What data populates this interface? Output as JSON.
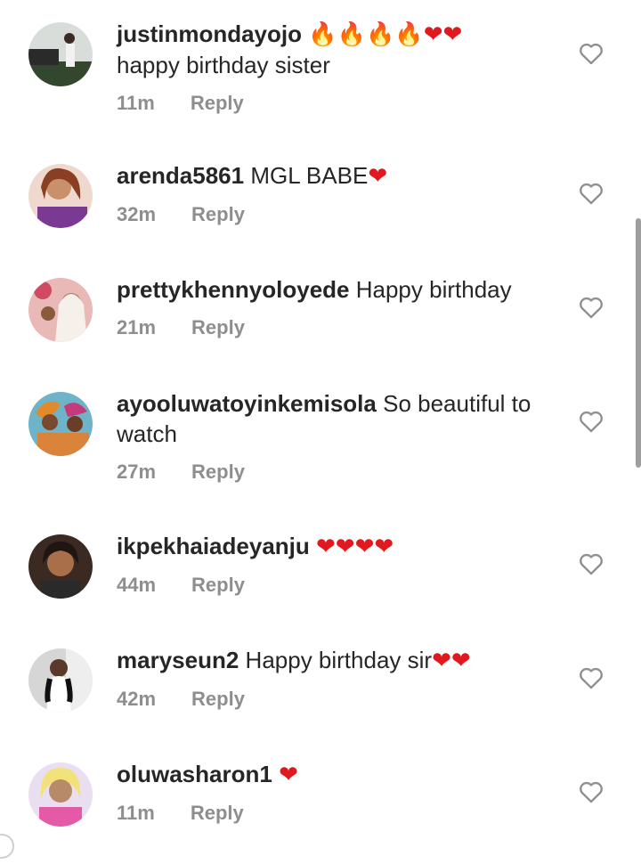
{
  "comments": [
    {
      "username": "justinmondayojo",
      "text": "",
      "emojis": "🔥🔥🔥🔥❤❤",
      "time": "11m",
      "reply": "Reply",
      "avatar_color": "#5a6b56"
    },
    {
      "username": "arenda5861",
      "text": " MGL BABE",
      "emojis": "❤",
      "time": "32m",
      "reply": "Reply",
      "avatar_color": "#7a4a8a"
    },
    {
      "username": "prettykhennyoloyede",
      "text": " Happy birthday",
      "emojis": "",
      "time": "21m",
      "reply": "Reply",
      "avatar_color": "#d4a3a6"
    },
    {
      "username": "ayooluwatoyinkemisola",
      "text": " So beautiful to watch",
      "emojis": "",
      "time": "27m",
      "reply": "Reply",
      "avatar_color": "#3e7f8c"
    },
    {
      "username": "ikpekhaiadeyanju",
      "text": " ",
      "emojis": "❤❤❤❤",
      "time": "44m",
      "reply": "Reply",
      "avatar_color": "#6b4a36"
    },
    {
      "username": "maryseun2",
      "text": " Happy birthday sir",
      "emojis": "❤❤",
      "time": "42m",
      "reply": "Reply",
      "avatar_color": "#c9c9c9"
    },
    {
      "username": "oluwasharon1",
      "text": " ",
      "emojis": "❤",
      "time": "11m",
      "reply": "Reply",
      "avatar_color": "#e58bbd"
    }
  ],
  "text_line2": {
    "justinmondayojo": "happy birthday sister"
  },
  "colors": {
    "username": "#262626",
    "meta": "#8e8e8e",
    "heart": "#e0191f",
    "fire": "#f68b1e"
  },
  "icons": {
    "like": "heart-outline-icon"
  }
}
